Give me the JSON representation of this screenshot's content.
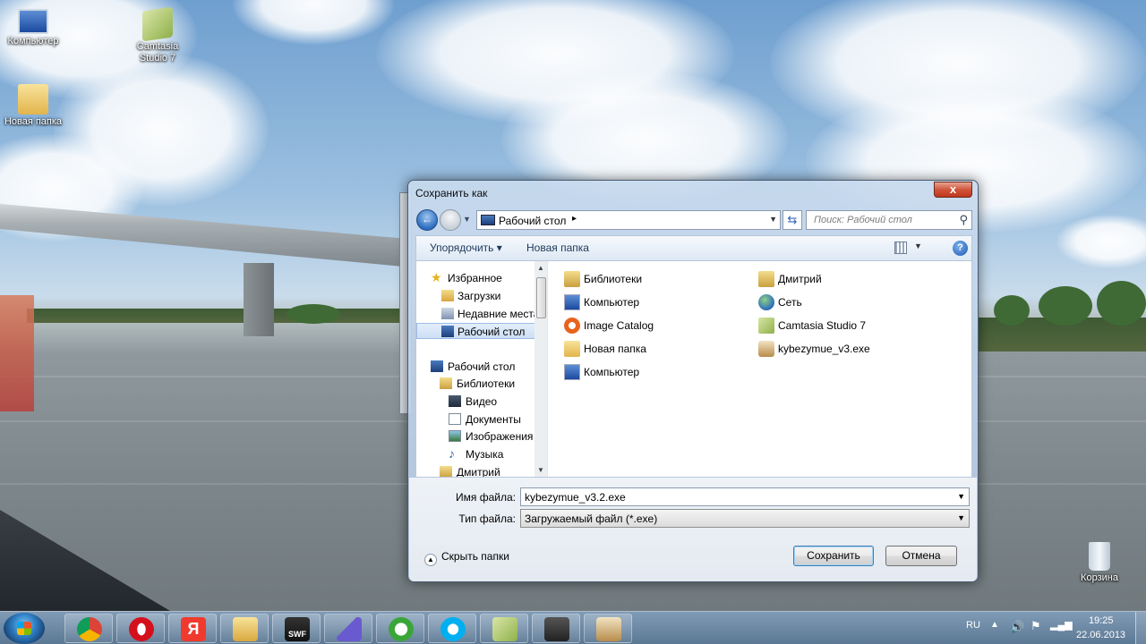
{
  "desktop": {
    "icons": [
      {
        "label": "Компьютер",
        "icon": "computer-icon"
      },
      {
        "label": "Camtasia Studio 7",
        "icon": "camtasia-icon"
      },
      {
        "label": "Новая папка",
        "icon": "folder-icon"
      },
      {
        "label": "Корзина",
        "icon": "recycle-bin-icon"
      }
    ]
  },
  "dialog": {
    "title": "Сохранить как",
    "close_label": "x",
    "address": {
      "location": "Рабочий стол",
      "separator": "▸"
    },
    "search_placeholder": "Поиск: Рабочий стол",
    "toolbar": {
      "organize": "Упорядочить ▾",
      "new_folder": "Новая папка",
      "help": "?"
    },
    "nav_pane": [
      {
        "label": "Избранное",
        "icon": "star-icon",
        "selected": false
      },
      {
        "label": "Загрузки",
        "icon": "downloads-icon",
        "selected": false
      },
      {
        "label": "Недавние места",
        "icon": "recent-places-icon",
        "selected": false
      },
      {
        "label": "Рабочий стол",
        "icon": "desktop-icon",
        "selected": true
      },
      {
        "label": "Рабочий стол",
        "icon": "desktop-icon",
        "selected": false
      },
      {
        "label": "Библиотеки",
        "icon": "libraries-icon",
        "selected": false
      },
      {
        "label": "Видео",
        "icon": "video-icon",
        "selected": false
      },
      {
        "label": "Документы",
        "icon": "documents-icon",
        "selected": false
      },
      {
        "label": "Изображения",
        "icon": "pictures-icon",
        "selected": false
      },
      {
        "label": "Музыка",
        "icon": "music-icon",
        "selected": false
      },
      {
        "label": "Дмитрий",
        "icon": "user-folder-icon",
        "selected": false
      }
    ],
    "files": [
      {
        "name": "Библиотеки",
        "icon": "libraries-icon"
      },
      {
        "name": "Компьютер",
        "icon": "computer-icon"
      },
      {
        "name": "Image Catalog",
        "icon": "image-catalog-icon"
      },
      {
        "name": "Новая папка",
        "icon": "folder-icon"
      },
      {
        "name": "Компьютер",
        "icon": "computer-shortcut-icon"
      },
      {
        "name": "Дмитрий",
        "icon": "user-folder-icon"
      },
      {
        "name": "Сеть",
        "icon": "network-icon"
      },
      {
        "name": "Camtasia Studio 7",
        "icon": "camtasia-icon"
      },
      {
        "name": "kybezymue_v3.exe",
        "icon": "exe-icon"
      }
    ],
    "filename_label": "Имя файла:",
    "filename_value": "kybezymue_v3.2.exe",
    "filetype_label": "Тип файла:",
    "filetype_value": "Загружаемый файл (*.exe)",
    "hide_folders": "Скрыть папки",
    "save_button": "Сохранить",
    "cancel_button": "Отмена"
  },
  "taskbar": {
    "apps": [
      "chrome-icon",
      "opera-icon",
      "yandex-icon",
      "explorer-icon",
      "swf-icon",
      "wizard-icon",
      "utorrent-icon",
      "skype-icon",
      "camtasia-icon",
      "camera-icon",
      "installer-icon"
    ],
    "yandex_letter": "Я",
    "swf_label": "SWF",
    "language": "RU",
    "time": "19:25",
    "date": "22.06.2013"
  },
  "colors": {
    "accent": "#2c6cc0",
    "close": "#c0371d",
    "selection": "#cddff5"
  }
}
